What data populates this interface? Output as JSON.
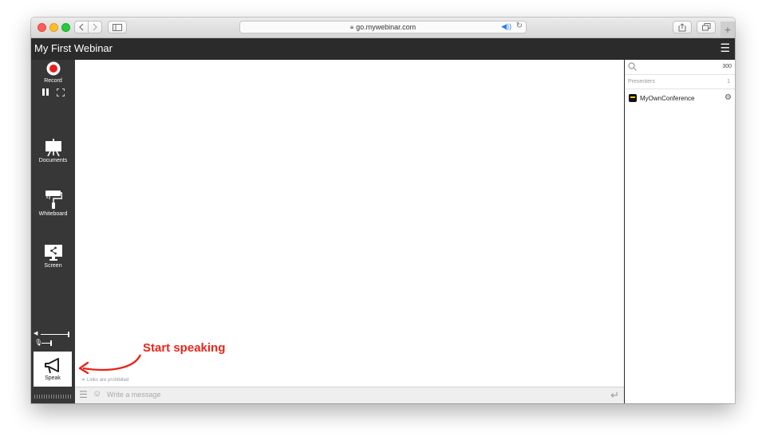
{
  "browser": {
    "url": "go.mywebinar.com",
    "traffic_lights": [
      "#fd5f57",
      "#febc2e",
      "#29c940"
    ]
  },
  "app": {
    "title": "My First Webinar",
    "header_bg": "#2b2b2b"
  },
  "sidebar": {
    "record_label": "Record",
    "documents_label": "Documents",
    "whiteboard_label": "Whiteboard",
    "screen_label": "Screen",
    "speak_label": "Speak"
  },
  "chat": {
    "links_note": "Links are prohibited",
    "placeholder": "Write a message"
  },
  "participants": {
    "count": "300",
    "presenters_label": "Presenters",
    "presenters_count": "1",
    "members": [
      {
        "name": "MyOwnConference"
      }
    ]
  },
  "annotation": {
    "text": "Start speaking",
    "color": "#e8261b"
  }
}
